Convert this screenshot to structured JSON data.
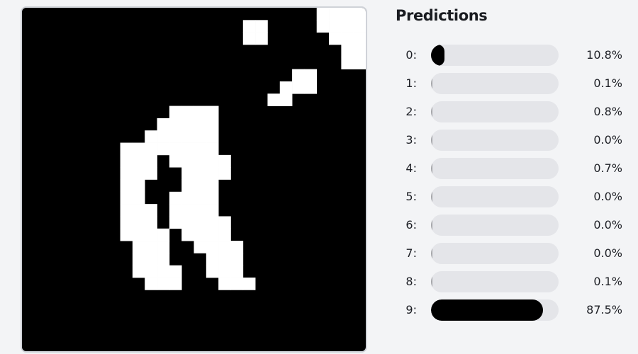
{
  "colors": {
    "canvas_bg": "#000000",
    "ink": "#ffffff",
    "bar_track": "#e4e5e9",
    "bar_fill": "#000000",
    "page_bg": "#f3f4f6"
  },
  "canvas": {
    "grid_size": 28,
    "pixel_rows": [
      "00000000000000000000000011111",
      "00000000000000000011000011111",
      "00000000000000000011000001111",
      "00000000000000000000000000111",
      "00000000000000000000000000111",
      "00000000000000000000001100000",
      "00000000000000000000011100000",
      "00000000000000000000110000000",
      "00000000000011110000000000000",
      "00000000000111110000000000000",
      "00000000001111110000000000000",
      "00000000111111110000000000000",
      "00000000111011111000000000000",
      "00000000111001111000000000000",
      "00000000110001110000000000000",
      "00000000110011110000000000000",
      "00000000111011110000000000000",
      "00000000111011111000000000000",
      "00000000111101111000000000000",
      "00000000011100111100000000000",
      "00000000011100011100000000000",
      "00000000011110011100000000000",
      "00000000001110001110000000000",
      "00000000000000000000000000000",
      "00000000000000000000000000000",
      "00000000000000000000000000000",
      "00000000000000000000000000000",
      "00000000000000000000000000000",
      "00000000000000000000000000000"
    ]
  },
  "predictions": {
    "title": "Predictions",
    "items": [
      {
        "label": "0:",
        "value": "10.8%",
        "fraction": 0.108
      },
      {
        "label": "1:",
        "value": "0.1%",
        "fraction": 0.001
      },
      {
        "label": "2:",
        "value": "0.8%",
        "fraction": 0.008
      },
      {
        "label": "3:",
        "value": "0.0%",
        "fraction": 0.0
      },
      {
        "label": "4:",
        "value": "0.7%",
        "fraction": 0.007
      },
      {
        "label": "5:",
        "value": "0.0%",
        "fraction": 0.0
      },
      {
        "label": "6:",
        "value": "0.0%",
        "fraction": 0.0
      },
      {
        "label": "7:",
        "value": "0.0%",
        "fraction": 0.0
      },
      {
        "label": "8:",
        "value": "0.1%",
        "fraction": 0.001
      },
      {
        "label": "9:",
        "value": "87.5%",
        "fraction": 0.875
      }
    ]
  }
}
